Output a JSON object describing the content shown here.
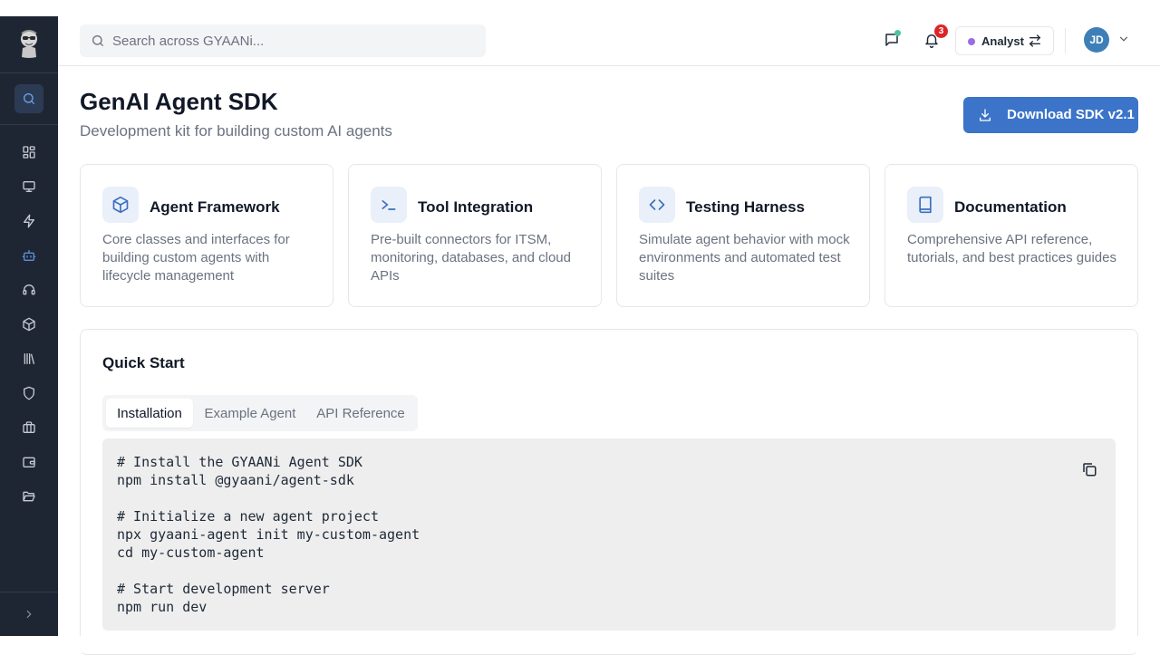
{
  "search": {
    "placeholder": "Search across GYAANi..."
  },
  "header": {
    "notification_count": "3",
    "role": {
      "label": "Analyst",
      "dot_color": "#9b6ce6"
    },
    "avatar_initials": "JD"
  },
  "sidebar": {
    "items": [
      {
        "icon": "search-icon"
      },
      {
        "icon": "dashboard-icon"
      },
      {
        "icon": "monitor-icon"
      },
      {
        "icon": "zap-icon"
      },
      {
        "icon": "bot-icon"
      },
      {
        "icon": "headset-icon"
      },
      {
        "icon": "package-icon"
      },
      {
        "icon": "library-icon"
      },
      {
        "icon": "shield-icon"
      },
      {
        "icon": "briefcase-icon"
      },
      {
        "icon": "wallet-icon"
      },
      {
        "icon": "folder-icon"
      }
    ]
  },
  "page": {
    "title": "GenAI Agent SDK",
    "subtitle": "Development kit for building custom AI agents",
    "download_label": "Download SDK v2.1"
  },
  "cards": [
    {
      "title": "Agent Framework",
      "desc": "Core classes and interfaces for building custom agents with lifecycle management",
      "icon": "package-icon"
    },
    {
      "title": "Tool Integration",
      "desc": "Pre-built connectors for ITSM, monitoring, databases, and cloud APIs",
      "icon": "terminal-icon"
    },
    {
      "title": "Testing Harness",
      "desc": "Simulate agent behavior with mock environments and automated test suites",
      "icon": "code-icon"
    },
    {
      "title": "Documentation",
      "desc": "Comprehensive API reference, tutorials, and best practices guides",
      "icon": "book-icon"
    }
  ],
  "quickstart": {
    "title": "Quick Start",
    "tabs": [
      "Installation",
      "Example Agent",
      "API Reference"
    ],
    "active_tab": "Installation",
    "code": "# Install the GYAANi Agent SDK\nnpm install @gyaani/agent-sdk\n\n# Initialize a new agent project\nnpx gyaani-agent init my-custom-agent\ncd my-custom-agent\n\n# Start development server\nnpm run dev"
  },
  "colors": {
    "sidebar_bg": "#1f2633",
    "accent": "#3b74c8",
    "badge": "#dc2626",
    "avatar": "#3f7fb7"
  }
}
